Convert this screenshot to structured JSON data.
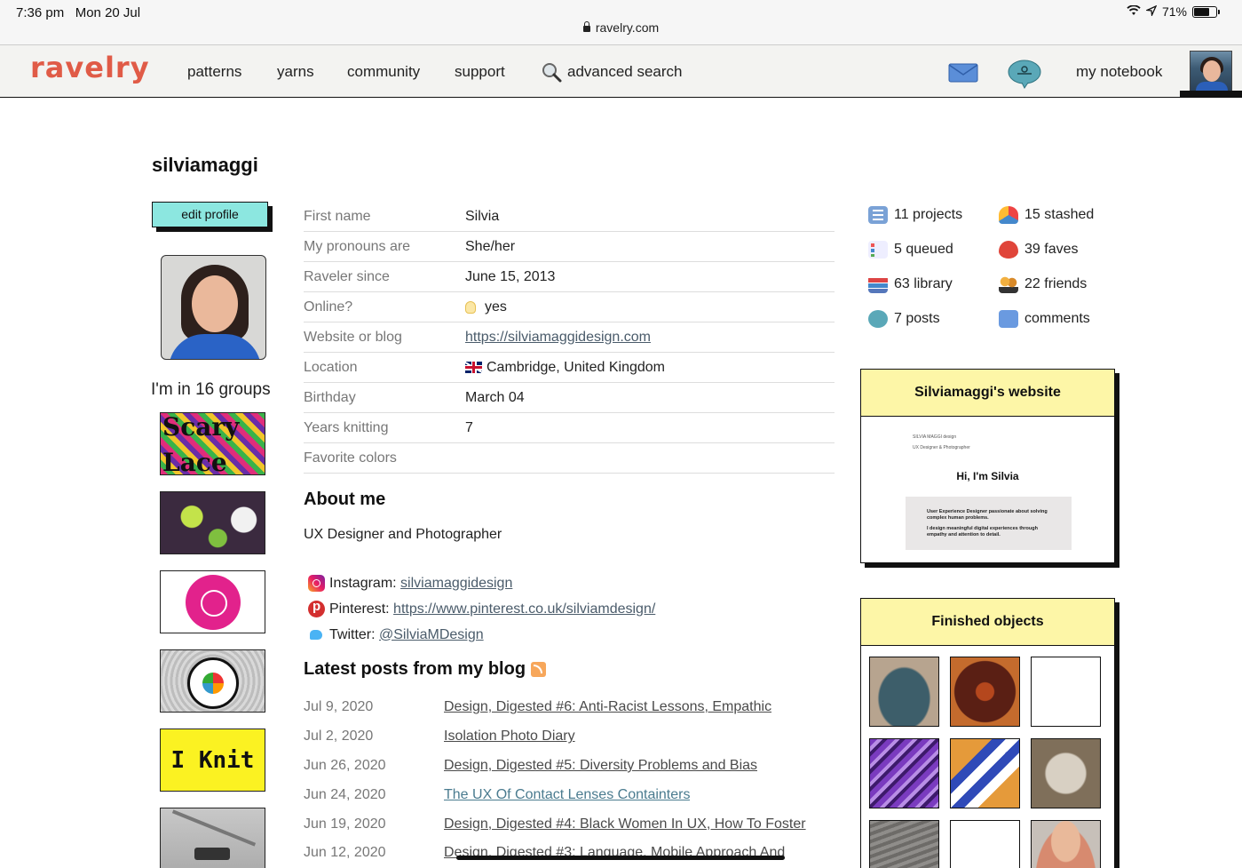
{
  "status": {
    "time": "7:36 pm",
    "date": "Mon 20 Jul",
    "url": "ravelry.com",
    "battery": "71%"
  },
  "nav": {
    "logo": "ravelry",
    "items": [
      "patterns",
      "yarns",
      "community",
      "support"
    ],
    "advanced_search": "advanced search",
    "notebook": "my notebook"
  },
  "profile": {
    "username": "silviamaggi",
    "edit_label": "edit profile",
    "groups_title": "I'm in 16 groups",
    "group_labels": {
      "scary_lace_line1": "Scary",
      "scary_lace_line2": "Lace",
      "i_knit": "I Knit"
    }
  },
  "details": [
    {
      "label": "First name",
      "value": "Silvia"
    },
    {
      "label": "My pronouns are",
      "value": "She/her"
    },
    {
      "label": "Raveler since",
      "value": "June 15, 2013"
    },
    {
      "label": "Online?",
      "value": "yes"
    },
    {
      "label": "Website or blog",
      "value": "https://silviamaggidesign.com"
    },
    {
      "label": "Location",
      "value": "Cambridge, United Kingdom"
    },
    {
      "label": "Birthday",
      "value": "March 04"
    },
    {
      "label": "Years knitting",
      "value": "7"
    },
    {
      "label": "Favorite colors",
      "value": ""
    }
  ],
  "about": {
    "heading": "About me",
    "text": "UX Designer and Photographer",
    "instagram_label": "Instagram:",
    "instagram": "silviamaggidesign",
    "pinterest_label": "Pinterest:",
    "pinterest": "https://www.pinterest.co.uk/silviamdesign/",
    "twitter_label": "Twitter:",
    "twitter": "@SilviaMDesign"
  },
  "blog": {
    "heading": "Latest posts from my blog",
    "posts": [
      {
        "date": "Jul 9, 2020",
        "title": "Design, Digested #6: Anti-Racist Lessons, Empathic"
      },
      {
        "date": "Jul 2, 2020",
        "title": "Isolation Photo Diary"
      },
      {
        "date": "Jun 26, 2020",
        "title": "Design, Digested #5: Diversity Problems and Bias"
      },
      {
        "date": "Jun 24, 2020",
        "title": "The UX Of Contact Lenses Containters"
      },
      {
        "date": "Jun 19, 2020",
        "title": "Design, Digested #4: Black Women In UX, How To Foster"
      },
      {
        "date": "Jun 12, 2020",
        "title": "Design, Digested #3: Language, Mobile Approach And"
      }
    ]
  },
  "stats": {
    "projects": "11 projects",
    "stashed": "15 stashed",
    "queued": "5 queued",
    "faves": "39 faves",
    "library": "63 library",
    "friends": "22 friends",
    "posts": "7 posts",
    "comments": "comments"
  },
  "website_card": {
    "title": "Silviamaggi's website",
    "preview_logo": "SILVIA MAGGI design",
    "preview_tagline": "UX Designer & Photographer",
    "preview_hi": "Hi, I'm Silvia",
    "preview_line1": "User Experience Designer passionate about solving complex human problems.",
    "preview_line2": "I design meaningful digital experiences through empathy and attention to detail."
  },
  "finished_objects": {
    "title": "Finished objects"
  },
  "colors": {
    "accent": "#e05b47",
    "edit_button": "#8ce7e0",
    "card_header": "#fdf6a7"
  }
}
